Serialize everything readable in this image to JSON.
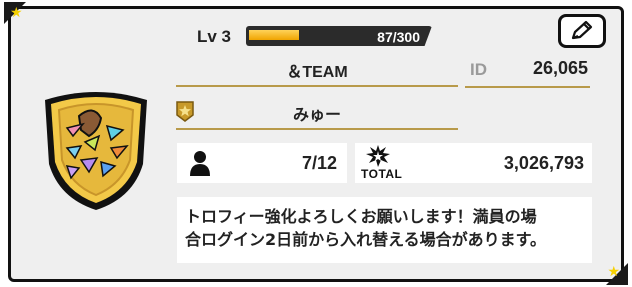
{
  "profile": {
    "level_label": "Lv 3",
    "xp_text": "87/300",
    "xp_fraction": 0.29,
    "team_name": "＆TEAM",
    "id_label": "ID",
    "id_value": "26,065",
    "player_name": "みゅー",
    "members": "7/12",
    "total_label": "TOTAL",
    "total_value": "3,026,793",
    "message": "トロフィー強化よろしくお願いします！満員の場\n合ログイン2日前から入れ替える場合があります。"
  },
  "icons": {
    "edit": "pencil-icon",
    "emblem": "team-emblem-shield",
    "rank": "rank-badge-icon",
    "member": "person-icon",
    "total": "burst-icon"
  },
  "colors": {
    "accent_gold": "#b89a4a",
    "xp_fill": "#f0a400",
    "star": "#f5d000"
  }
}
